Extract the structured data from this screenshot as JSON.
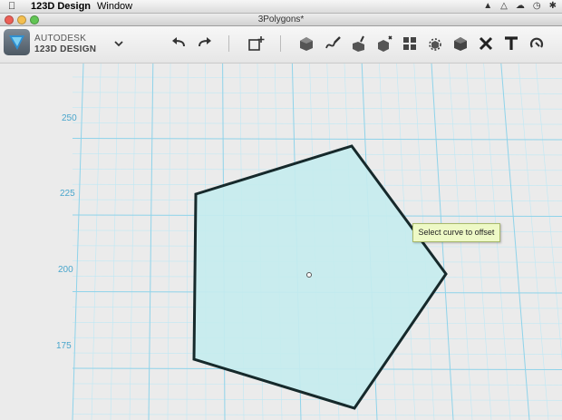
{
  "menubar": {
    "app_name": "123D Design",
    "menu_window": "Window"
  },
  "window": {
    "title": "3Polygons*"
  },
  "brand": {
    "line1": "AUTODESK",
    "line2": "123D DESIGN"
  },
  "canvas": {
    "axis_labels": [
      "250",
      "225",
      "200",
      "175"
    ],
    "tooltip": "Select curve to offset"
  },
  "colors": {
    "grid_line": "#8fd3ea",
    "polygon_fill": "#c6ecee",
    "polygon_stroke": "#16292b",
    "tooltip_bg": "#eef9c6",
    "axis_text": "#4aa6cc"
  }
}
